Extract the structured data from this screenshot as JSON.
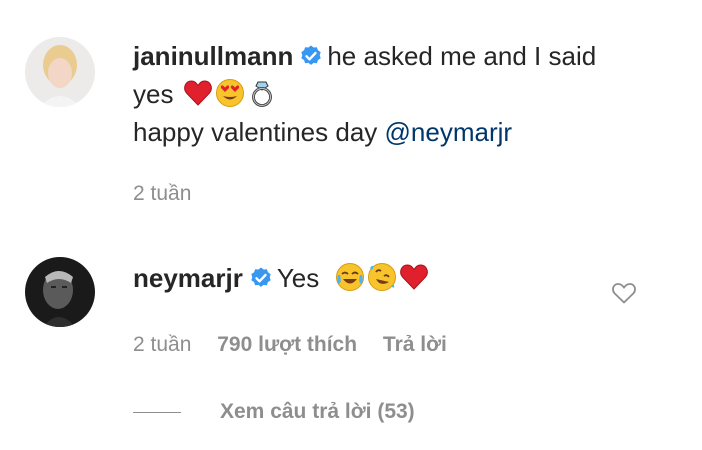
{
  "comment1": {
    "username": "janinullmann",
    "text_main": "he asked me and I said yes",
    "text_line2": "happy valentines day ",
    "mention": "@neymarjr",
    "time": "2 tuần"
  },
  "comment2": {
    "username": "neymarjr",
    "text": "Yes",
    "time": "2 tuần",
    "likes": "790 lượt thích",
    "reply_label": "Trả lời"
  },
  "view_replies": "Xem câu trả lời (53)",
  "icons": {
    "verified": "verified-badge-icon",
    "heart": "heart-outline-icon"
  },
  "colors": {
    "verified": "#3897f0",
    "link": "#00376b",
    "meta": "#8e8e8e"
  }
}
